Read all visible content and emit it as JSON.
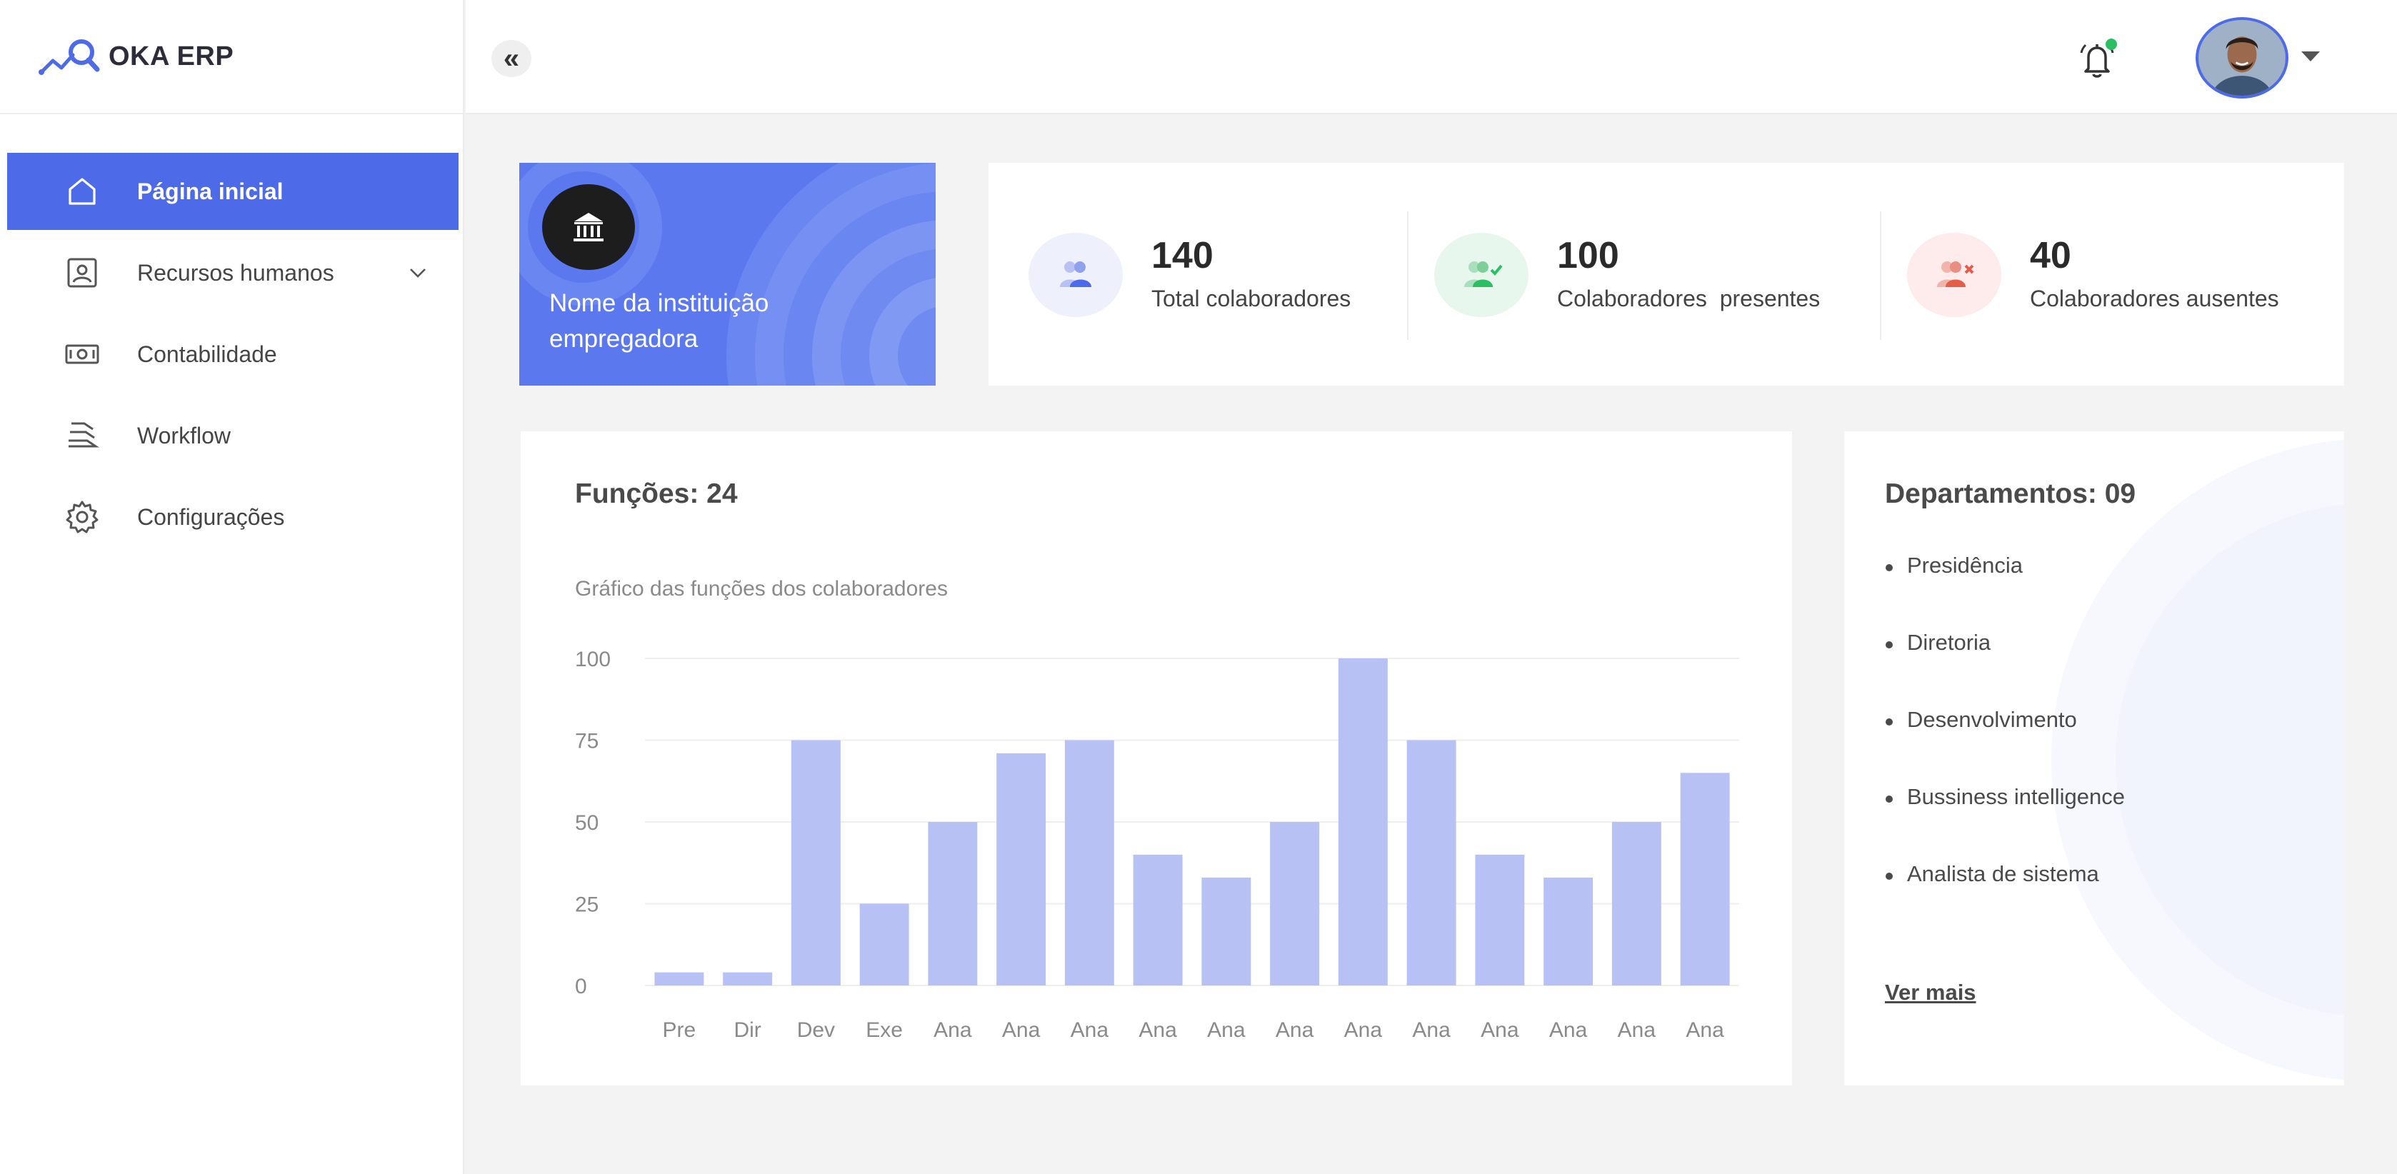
{
  "app": {
    "name": "OKA ERP"
  },
  "sidebar": {
    "items": [
      {
        "label": "Página inicial",
        "icon": "home-icon",
        "active": true
      },
      {
        "label": "Recursos humanos",
        "icon": "id-card-icon",
        "expandable": true
      },
      {
        "label": "Contabilidade",
        "icon": "banknote-icon"
      },
      {
        "label": "Workflow",
        "icon": "workflow-icon"
      },
      {
        "label": "Configurações",
        "icon": "gear-icon"
      }
    ]
  },
  "header": {
    "collapse_label": "«",
    "notifications": {
      "icon": "bell-icon",
      "has_unread": true,
      "dot_color": "#2bbf63"
    },
    "avatar": {
      "icon": "user-avatar"
    }
  },
  "institution": {
    "name": "Nome da instituição empregadora",
    "icon": "bank-icon",
    "color": "#5b78ee"
  },
  "stats": [
    {
      "value": "140",
      "label": "Total colaboradores",
      "icon": "users-icon",
      "color": "#4d6ae8",
      "bg": "#eef0fc"
    },
    {
      "value": "100",
      "label": "Colaboradores  presentes",
      "icon": "users-check-icon",
      "color": "#2bbf63",
      "bg": "#e8f7ee"
    },
    {
      "value": "40",
      "label": "Colaboradores ausentes",
      "icon": "users-x-icon",
      "color": "#e35d4a",
      "bg": "#fdeceb"
    }
  ],
  "functions_card": {
    "title": "Funções: 24",
    "subtitle": "Gráfico das funções dos colaboradores"
  },
  "chart_data": {
    "type": "bar",
    "title": "",
    "xlabel": "",
    "ylabel": "",
    "ylim": [
      0,
      100
    ],
    "yticks": [
      0,
      25,
      50,
      75,
      100
    ],
    "grid": true,
    "bar_color": "#b8c1f4",
    "categories": [
      "Pre",
      "Dir",
      "Dev",
      "Exe",
      "Ana",
      "Ana",
      "Ana",
      "Ana",
      "Ana",
      "Ana",
      "Ana",
      "Ana",
      "Ana",
      "Ana",
      "Ana",
      "Ana"
    ],
    "values": [
      4,
      4,
      75,
      25,
      50,
      71,
      75,
      40,
      33,
      50,
      100,
      75,
      40,
      33,
      50,
      65
    ]
  },
  "departments_card": {
    "title": "Departamentos: 09",
    "items": [
      "Presidência",
      "Diretoria",
      "Desenvolvimento",
      "Bussiness intelligence",
      "Analista de sistema"
    ],
    "see_more": "Ver mais"
  }
}
